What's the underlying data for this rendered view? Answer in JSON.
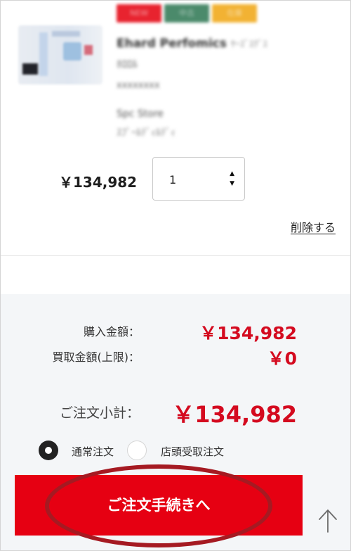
{
  "product": {
    "tags": [
      {
        "label": "NEW",
        "color": "#e8232f"
      },
      {
        "label": "中古",
        "color": "#4b8a6b"
      },
      {
        "label": "在庫",
        "color": "#f2b233"
      }
    ],
    "name_blurred": "Ehard Perfomics",
    "name_tail_blurred": "ﾔｰｽﾞｽｸﾞｽ",
    "name_line2_blurred": "ﾎﾛﾛﾙ",
    "code_blurred": "xxxxxxxx",
    "condition_line1_blurred": "Spc Store",
    "condition_line2_blurred": "ｽﾌﾟｰﾙﾃﾞｨﾙﾃﾞｨ",
    "price": "￥134,982",
    "quantity": "1",
    "delete_label": "削除する"
  },
  "summary": {
    "purchase_label": "購入金額：",
    "purchase_amount": "￥134,982",
    "buyback_label": "買取金額(上限)：",
    "buyback_amount": "￥0",
    "subtotal_label": "ご注文小計：",
    "subtotal_amount": "￥134,982"
  },
  "order_type": {
    "options": [
      {
        "label": "通常注文",
        "selected": true
      },
      {
        "label": "店頭受取注文",
        "selected": false
      }
    ]
  },
  "checkout": {
    "label": "ご注文手続きへ"
  },
  "colors": {
    "accent": "#e60012",
    "price_red": "#d40a1f",
    "annotation": "#a51a22",
    "panel_bg": "#f4f6f8"
  }
}
